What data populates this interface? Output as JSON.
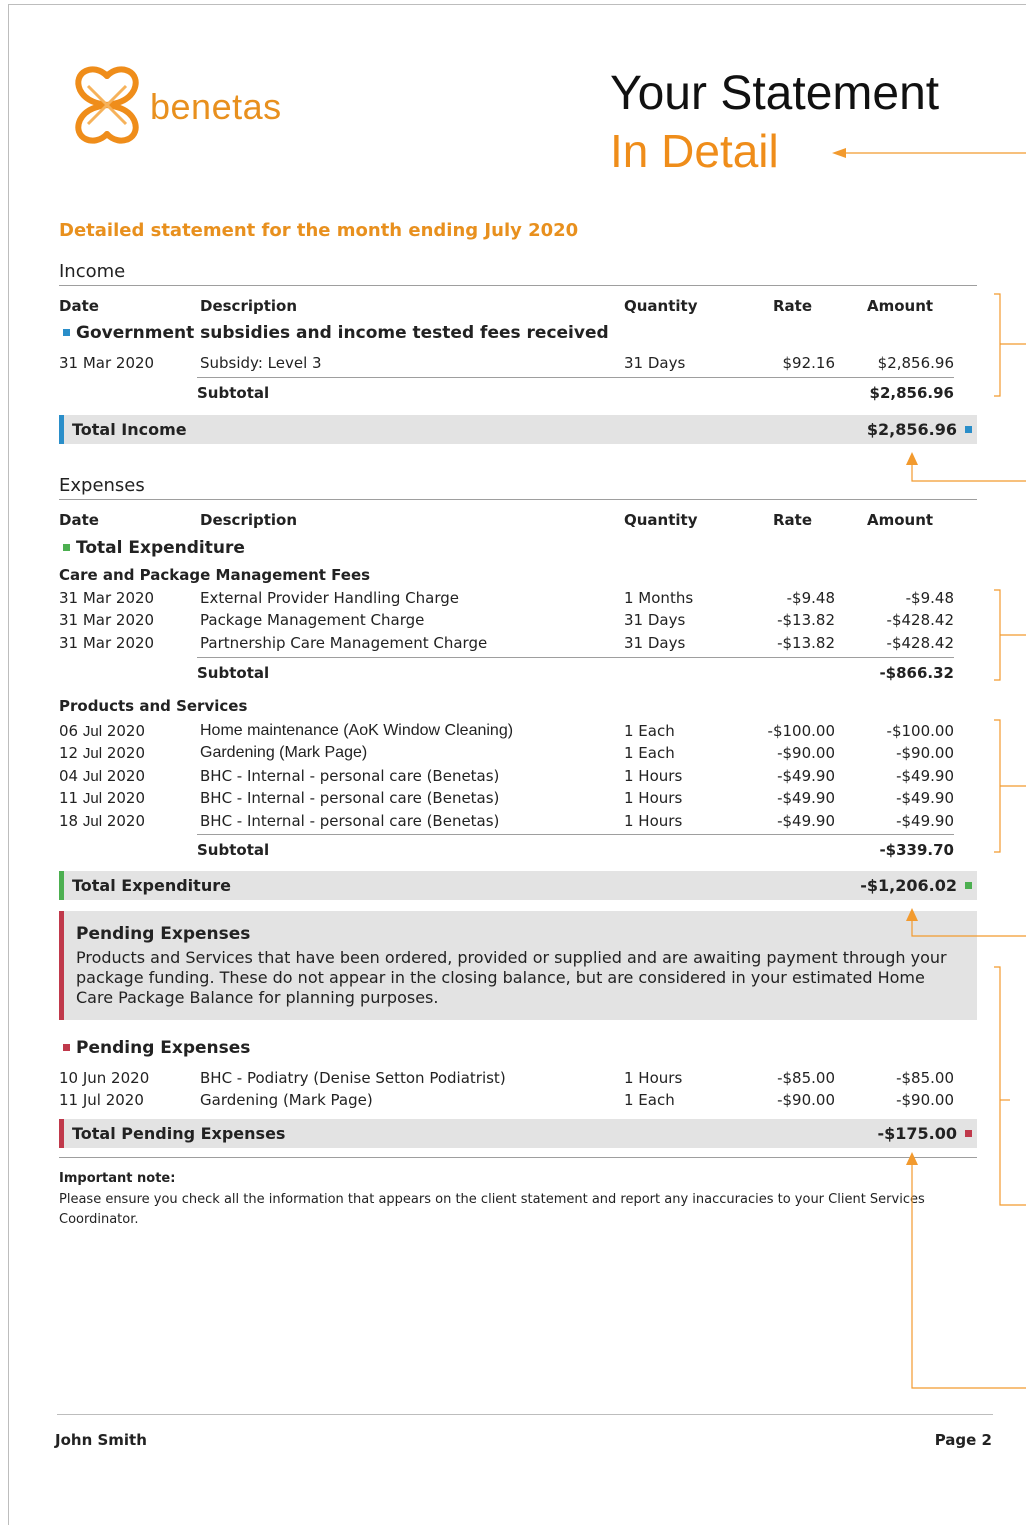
{
  "header": {
    "logo_text": "benetas",
    "title_line1": "Your Statement",
    "title_line2": "In Detail"
  },
  "statement_heading": "Detailed statement for the month ending July 2020",
  "columns": {
    "date": "Date",
    "description": "Description",
    "quantity": "Quantity",
    "rate": "Rate",
    "amount": "Amount"
  },
  "income": {
    "label": "Income",
    "category": "Government subsidies and income tested fees received",
    "rows": [
      {
        "date": "31 Mar 2020",
        "description": "Subsidy: Level 3",
        "quantity": "31 Days",
        "rate": "$92.16",
        "amount": "$2,856.96"
      }
    ],
    "subtotal_label": "Subtotal",
    "subtotal": "$2,856.96",
    "total_label": "Total Income",
    "total": "$2,856.96"
  },
  "expenses": {
    "label": "Expenses",
    "category": "Total Expenditure",
    "care_group": {
      "title": "Care and Package Management Fees",
      "rows": [
        {
          "date": "31 Mar 2020",
          "description": "External Provider Handling Charge",
          "quantity": "1 Months",
          "rate": "-$9.48",
          "amount": "-$9.48"
        },
        {
          "date": "31 Mar 2020",
          "description": "Package Management Charge",
          "quantity": "31 Days",
          "rate": "-$13.82",
          "amount": "-$428.42"
        },
        {
          "date": "31 Mar 2020",
          "description": "Partnership Care Management Charge",
          "quantity": "31 Days",
          "rate": "-$13.82",
          "amount": "-$428.42"
        }
      ],
      "subtotal_label": "Subtotal",
      "subtotal": "-$866.32"
    },
    "products_group": {
      "title": "Products and Services",
      "rows": [
        {
          "date_day": "06",
          "date_month": "Jul",
          "date_year": "2020",
          "description": "Home maintenance (AoK Window Cleaning)",
          "quantity": "1 Each",
          "rate": "-$100.00",
          "amount": "-$100.00"
        },
        {
          "date_day": "12",
          "date_month": "Jul",
          "date_year": "2020",
          "description": "Gardening (Mark Page)",
          "quantity": "1 Each",
          "rate": "-$90.00",
          "amount": "-$90.00"
        },
        {
          "date_day": "04",
          "date_month": "Jul",
          "date_year": "2020",
          "description": "BHC - Internal - personal care (Benetas)",
          "quantity": "1 Hours",
          "rate": "-$49.90",
          "amount": "-$49.90"
        },
        {
          "date_day": "11",
          "date_month": "Jul",
          "date_year": "2020",
          "description": "BHC - Internal - personal care (Benetas)",
          "quantity": "1 Hours",
          "rate": "-$49.90",
          "amount": "-$49.90"
        },
        {
          "date_day": "18",
          "date_month": "Jul",
          "date_year": "2020",
          "description": "BHC - Internal - personal care (Benetas)",
          "quantity": "1 Hours",
          "rate": "-$49.90",
          "amount": "-$49.90"
        }
      ],
      "subtotal_label": "Subtotal",
      "subtotal": "-$339.70"
    },
    "total_label": "Total Expenditure",
    "total": "-$1,206.02"
  },
  "pending": {
    "box_title": "Pending Expenses",
    "box_text": "Products and Services that have been ordered, provided or supplied and are awaiting payment through your package funding. These do not appear in the closing balance, but are considered in your estimated Home Care Package Balance for planning purposes.",
    "category": "Pending Expenses",
    "rows": [
      {
        "date": "10 Jun 2020",
        "description": "BHC - Podiatry (Denise Setton Podiatrist)",
        "quantity": "1 Hours",
        "rate": "-$85.00",
        "amount": "-$85.00"
      },
      {
        "date": "11 Jul 2020",
        "description": "Gardening (Mark Page)",
        "quantity": "1 Each",
        "rate": "-$90.00",
        "amount": "-$90.00"
      }
    ],
    "total_label": "Total Pending Expenses",
    "total": "-$175.00"
  },
  "note": {
    "title": "Important note:",
    "text": "Please ensure you check all the information that appears on the client statement and report any inaccuracies to your Client Services Coordinator."
  },
  "footer": {
    "name": "John Smith",
    "page": "Page 2"
  },
  "colors": {
    "brand_orange": "#ef8d1a",
    "income_blue": "#2a8ec9",
    "expense_green": "#4caf50",
    "pending_red": "#c0394b",
    "bar_grey": "#e3e3e3"
  },
  "icons": {
    "logo": "benetas-knot-logo-icon",
    "marker": "square-marker-icon",
    "annotation": "arrow-annotation-icon"
  }
}
